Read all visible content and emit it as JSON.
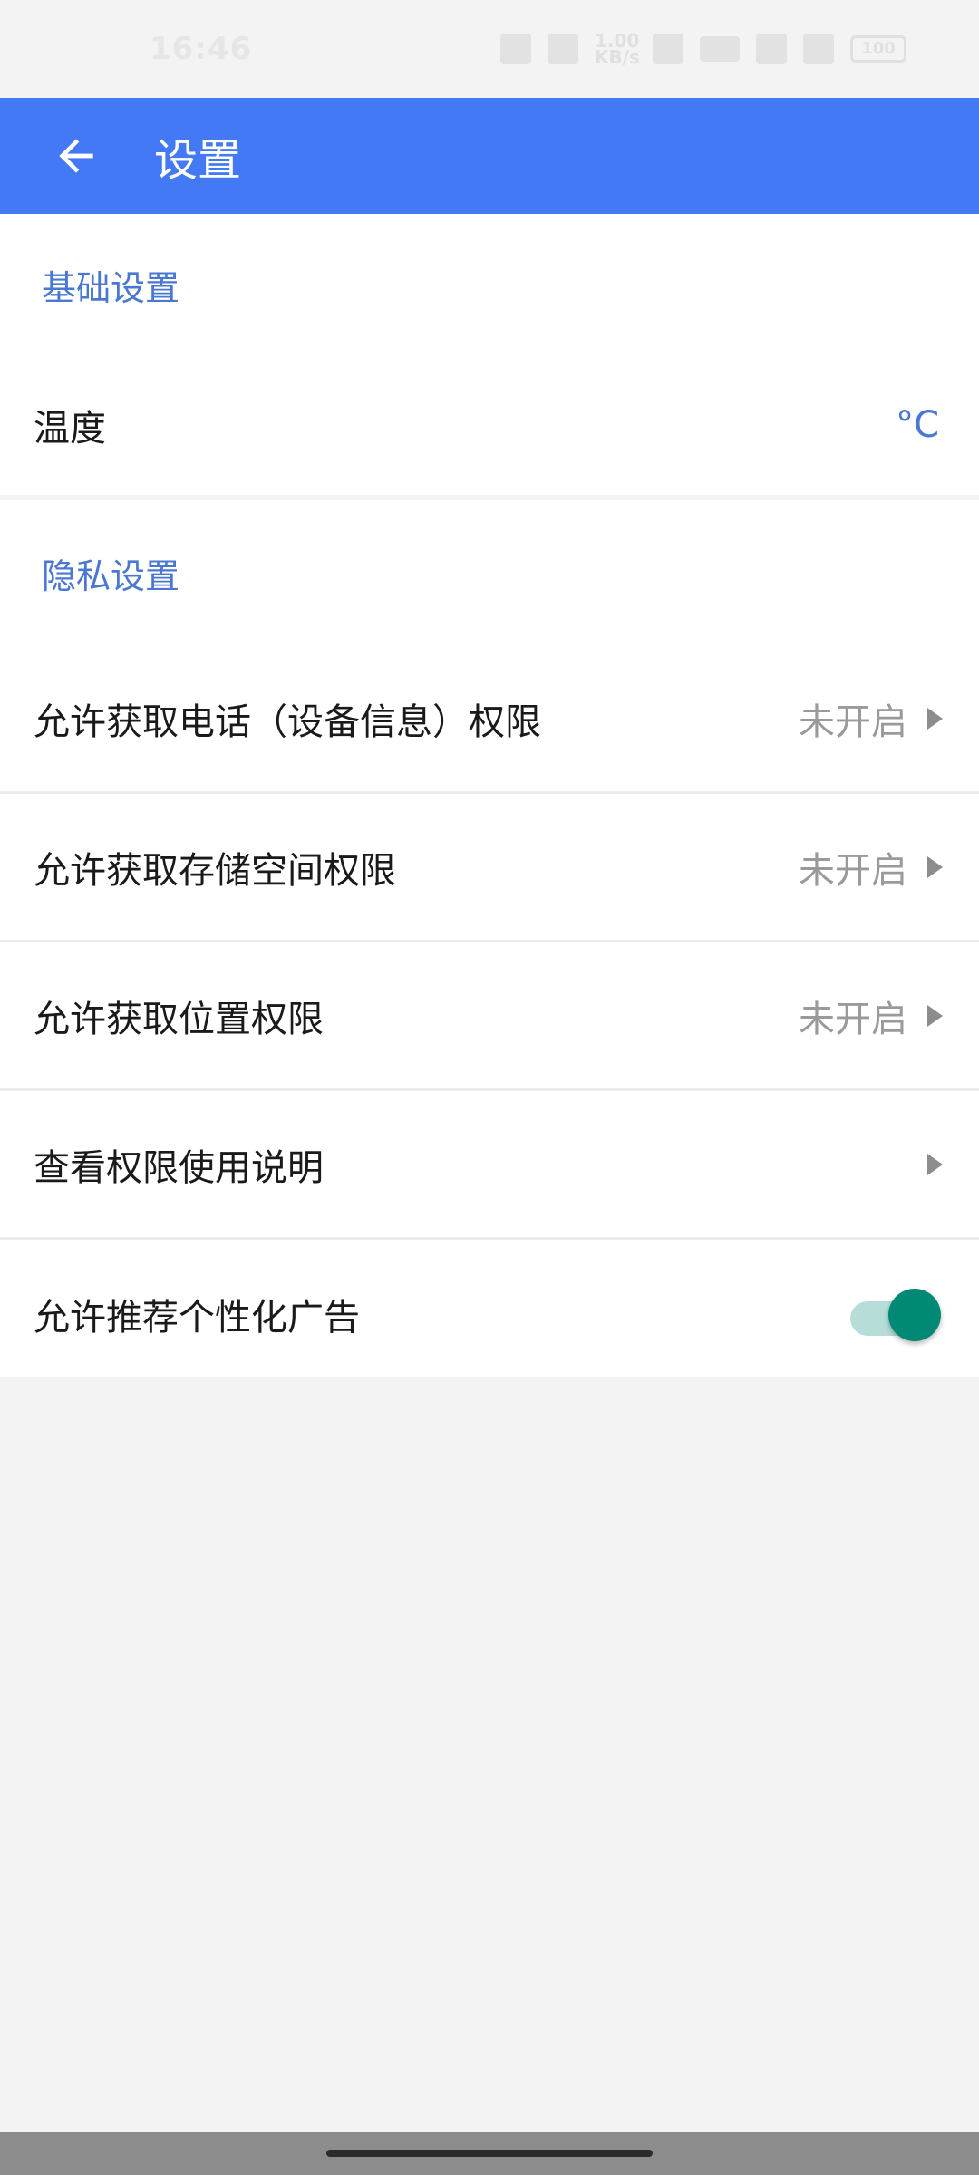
{
  "status_bar": {
    "time": "16:46",
    "net_speed": "1.00 KB/s",
    "battery": "100"
  },
  "app_bar": {
    "title": "设置"
  },
  "sections": {
    "basic": {
      "header": "基础设置",
      "temperature": {
        "label": "温度",
        "value": "°C"
      }
    },
    "privacy": {
      "header": "隐私设置",
      "items": [
        {
          "label": "允许获取电话（设备信息）权限",
          "value": "未开启"
        },
        {
          "label": "允许获取存储空间权限",
          "value": "未开启"
        },
        {
          "label": "允许获取位置权限",
          "value": "未开启"
        },
        {
          "label": "查看权限使用说明",
          "value": ""
        },
        {
          "label": "允许推荐个性化广告",
          "toggle_on": true
        }
      ]
    }
  },
  "colors": {
    "app_bar": "#4479f5",
    "section_header": "#4a77d1",
    "toggle_thumb": "#008a76",
    "toggle_track": "#b6ddd7"
  },
  "icons": {
    "back": "arrow-left-icon",
    "chevron": "chevron-right-icon"
  }
}
